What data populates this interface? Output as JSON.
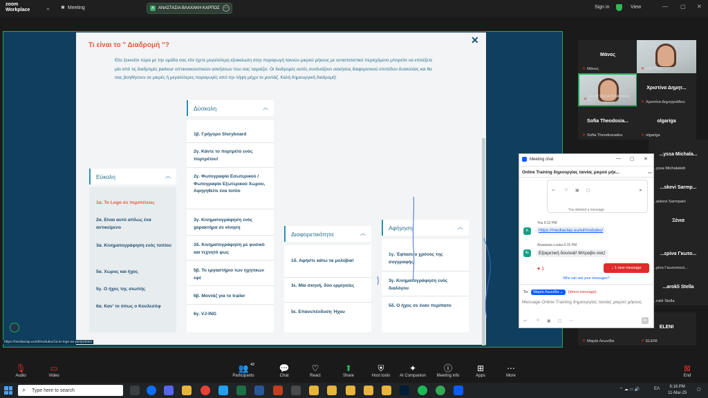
{
  "app": {
    "logo_line1": "zoom",
    "logo_line2": "Workplace",
    "meeting_label": "Meeting",
    "sharer_name": "ΑΝΑΣΤΑΣΙΑ ΒΛΑΧΑΚΗ ΚΑΡΠΟΣ",
    "sharer_initial": "A",
    "sign_in": "Sign in",
    "view": "View"
  },
  "modal": {
    "title": "Τι είναι το \" Διαδρομή \"?",
    "intro": "Είτε ξεκινάτε τώρα με την ομάδα σας είτε έχετε μεγαλύτερη εξοικείωση στην παραγωγή ταινιών μικρού μήκους με αντιστατιστικό περιεχόμενο μπορείτε να επιλέξετε μία από τις διαδρομές parkour οπτικοακουστικών ασκήσεων που σας ταιριάζει. Οι διαδρομές αυτές συνδυάζουν ασκήσεις διαφορετικού επιπέδου δυσκολίας και θα σας βοηθήσουν σε μικρές ή μεγαλύτερες παραγωγές από την λήψη μέχρι το μοντάζ. Καλή δημιουργική διαδρομή!",
    "columns": {
      "easy": {
        "header": "Εύκολη",
        "items": [
          "1α. Το Logo σε περιπέτειες",
          "2α. Είναι αυτό απλώς ένα αντικείμενο",
          "3α. Κινηματογράφηση ενός τοπίου",
          "5α. Χώρος και ήχος",
          "5γ. Ο ήχος της σιωπής",
          "6α. Καν' το όπως ο Κουλεσόφ"
        ]
      },
      "hard": {
        "header": "Δύσκολη",
        "items": [
          "1β. Γρήγορο Storyboard",
          "2γ. Κάντε το πορτρέτο ενός πορτρέτου!",
          "2γ. Φωτογραφία Εσωτερικού / Φωτογραφία Εξωτερικού Χώρου, Αφηγηθείτε ένα τοπίο",
          "3γ. Κινηματογράφηση ενός χαρακτήρα σε κίνηση",
          "3δ. Κινηματογράφηση με φυσικό και τεχνητό φως",
          "5β. Το εργαστήριο των ηχητικών εφέ",
          "6β. Μοντάζ για το trailer",
          "6γ. VJ-ING"
        ]
      },
      "diversity": {
        "header": "Διαφορετικότητα",
        "items": [
          "1δ. Αφήστε κάτω τα μολύβια!",
          "3ε. Μία σκηνή, δύο ερμηνείες",
          "5ε. Επανεπένδυση Ήχου"
        ]
      },
      "narration": {
        "header": "Αφήγηση",
        "items": [
          "1γ. Έφτασε ο χρόνος της συγγραφής",
          "3γ. Κινηματογράφηση ενός διαλόγου",
          "5δ. Ο ήχος σε έναν περίπατο"
        ]
      }
    },
    "status_url": "https://mediaclap.eu/el/modules/1a-to-logo-se-peripeteies"
  },
  "chat": {
    "window_title": "Meeting chat",
    "subtitle": "Online Training δημιουργίας ταινίας μικρού μήκ...",
    "deleted_note": "You deleted a message",
    "msg1_head": "You 6:12 PM",
    "msg1_link": "https://mediaclap.eu/el/modules/",
    "msg2_head": "Anastasia Louka 6:15 PM",
    "msg2_initials": "AL",
    "msg2_text": "Εξαιρετική δουλειά! Μπραβο σας!",
    "reaction_count": "1",
    "new_message": "1 new message",
    "who_can_see": "Who can see your messages?",
    "to_label": "To:",
    "to_recipient": "Μαρία Λεωνίδα",
    "direct_label": "(direct message)",
    "compose_placeholder": "Message Online Training δημιουργίας ταινίας μικρού μήκους"
  },
  "participants": [
    {
      "center": "Μάνος",
      "tag": "Μάνος"
    },
    {
      "center": "",
      "tag": "ΚΑΡΠΟΣ"
    },
    {
      "center": "",
      "tag": "ΑΝΑΣΤΑΣΙΑ ΒΛΑΧΑΚΗ Κ..."
    },
    {
      "center": "Χριστίνα Δημητ...",
      "tag": "Χριστίνα Δημητριάδου"
    },
    {
      "center": "Sofia Theodosia...",
      "tag": "Sofia Theodosiadou"
    },
    {
      "center": "olgariga",
      "tag": "olgariga"
    },
    {
      "center": "...yssa Michala...",
      "tag": "...yssa Michalakidi"
    },
    {
      "center": "...skevi Sarmp...",
      "tag": "...askevi Sarmpani"
    },
    {
      "center": "Ξένια",
      "tag": ""
    },
    {
      "center": "...ερίνα Γκωτο...",
      "tag": "...ρίνα Γκωτοπουλ..."
    },
    {
      "center": "...arokli Stella",
      "tag": "...rokli Stella"
    },
    {
      "center": "",
      "tag": "Μαρία Λεωνίδα"
    },
    {
      "center": "ELENI",
      "tag": "ELENI"
    }
  ],
  "toolbar": {
    "audio": "Audio",
    "video": "Video",
    "participants": "Participants",
    "participants_count": "42",
    "chat": "Chat",
    "react": "React",
    "share": "Share",
    "host_tools": "Host tools",
    "ai_companion": "AI Companion",
    "meeting_info": "Meeting info",
    "apps": "Apps",
    "more": "More",
    "end": "End"
  },
  "taskbar": {
    "search_placeholder": "Type here to search",
    "time": "6:16 PM",
    "date": "11-Mar-25",
    "lang": "EΛ"
  },
  "colors": {
    "accent_orange": "#e25a3c",
    "teal_text": "#2b6f8e",
    "zoom_blue": "#0b5cff",
    "share_green": "#1fae5a"
  }
}
